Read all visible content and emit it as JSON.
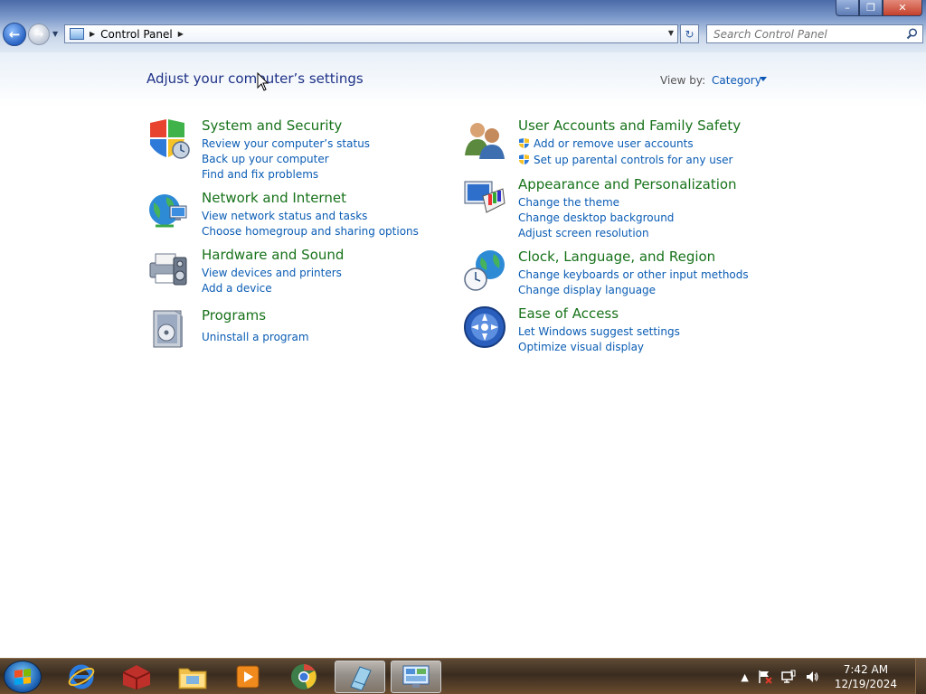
{
  "window": {
    "controls": {
      "minimize": "–",
      "maximize": "❐",
      "close": "✕"
    }
  },
  "navigation": {
    "back_icon": "arrow-left-icon",
    "forward_icon": "arrow-right-icon",
    "history_icon": "chevron-down-icon"
  },
  "address_bar": {
    "location": "Control Panel",
    "icon": "control-panel-icon"
  },
  "search": {
    "placeholder": "Search Control Panel"
  },
  "header": {
    "title": "Adjust your computer’s settings",
    "view_by_label": "View by:",
    "view_by_value": "Category"
  },
  "categories_left": [
    {
      "title": "System and Security",
      "icon": "shield-icon",
      "links": [
        "Review your computer’s status",
        "Back up your computer",
        "Find and fix problems"
      ]
    },
    {
      "title": "Network and Internet",
      "icon": "network-globe-icon",
      "links": [
        "View network status and tasks",
        "Choose homegroup and sharing options"
      ]
    },
    {
      "title": "Hardware and Sound",
      "icon": "printer-speaker-icon",
      "links": [
        "View devices and printers",
        "Add a device"
      ]
    },
    {
      "title": "Programs",
      "icon": "programs-box-icon",
      "links": [
        "Uninstall a program"
      ]
    }
  ],
  "categories_right": [
    {
      "title": "User Accounts and Family Safety",
      "icon": "users-icon",
      "links": [
        "Add or remove user accounts",
        "Set up parental controls for any user"
      ]
    },
    {
      "title": "Appearance and Personalization",
      "icon": "monitor-palette-icon",
      "links": [
        "Change the theme",
        "Change desktop background",
        "Adjust screen resolution"
      ]
    },
    {
      "title": "Clock, Language, and Region",
      "icon": "globe-clock-icon",
      "links": [
        "Change keyboards or other input methods",
        "Change display language"
      ]
    },
    {
      "title": "Ease of Access",
      "icon": "ease-of-access-icon",
      "links": [
        "Let Windows suggest settings",
        "Optimize visual display"
      ]
    }
  ],
  "taskbar": {
    "items": [
      "internet-explorer-icon",
      "winrar-icon",
      "file-explorer-icon",
      "media-player-icon",
      "chrome-icon",
      "notepad-icon",
      "control-panel-icon"
    ],
    "tray": {
      "time": "7:42 AM",
      "date": "12/19/2024"
    }
  },
  "colors": {
    "category_title": "#17721a",
    "link": "#0a5cb4",
    "page_title": "#1e3287"
  }
}
